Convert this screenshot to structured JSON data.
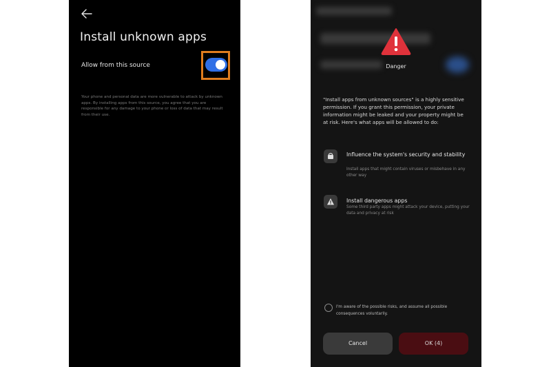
{
  "left": {
    "title": "Install unknown apps",
    "allow_label": "Allow from this source",
    "allow_enabled": true,
    "description": "Your phone and personal data are more vulnerable to attack by unknown apps. By installing apps from this source, you agree that you are responsible for any damage to your phone or loss of data that may result from their use.",
    "icons": {
      "back": "back-arrow-icon"
    },
    "colors": {
      "toggle_on": "#2f6fe6",
      "highlight": "#e07d1e"
    }
  },
  "right": {
    "danger_label": "Danger",
    "intro": "\"Install apps from unknown sources\" is a highly sensitive permission. If you grant this permission, your private information might be leaked and your property might be at risk. Here's what apps will be allowed to do:",
    "permissions": [
      {
        "title": "Influence the system's security and stability",
        "description": "Install apps that might contain viruses or misbehave in any other way",
        "icon": "shield-lock-icon"
      },
      {
        "title": "Install dangerous apps",
        "description": "Some third party apps might attack your device, putting your data and privacy at risk",
        "icon": "warning-icon"
      }
    ],
    "acknowledge": "I'm aware of the possible risks, and assume all possible consequences voluntarily.",
    "acknowledged": false,
    "cancel_label": "Cancel",
    "ok_label": "OK (4)",
    "colors": {
      "danger": "#e0323b",
      "ok_bg": "#4a0d12",
      "cancel_bg": "#3a3a3a"
    }
  }
}
